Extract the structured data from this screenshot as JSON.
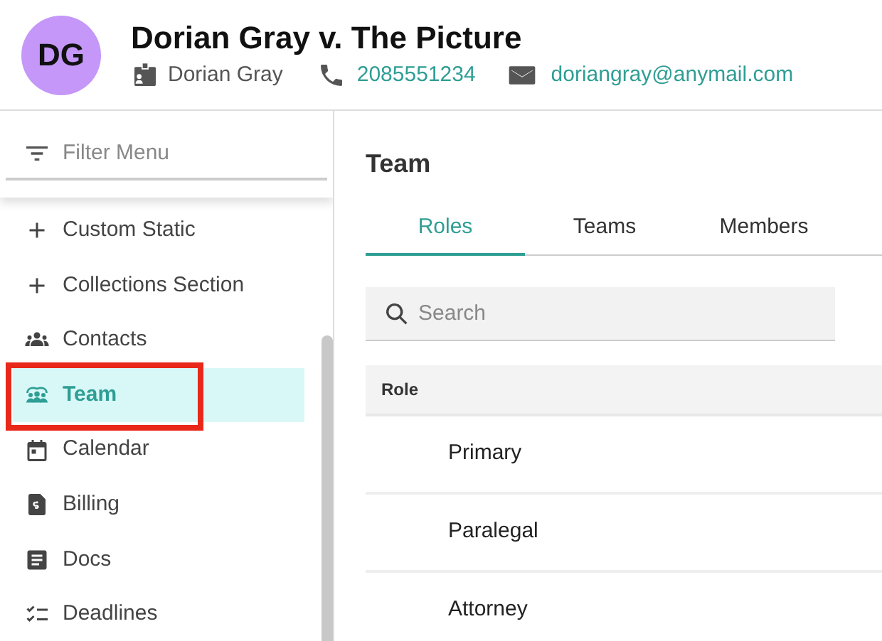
{
  "header": {
    "avatar": "DG",
    "title": "Dorian Gray v. The Picture",
    "client": "Dorian Gray",
    "phone": "2085551234",
    "email": "doriangray@anymail.com"
  },
  "sidebar": {
    "filter": {
      "placeholder": "Filter Menu"
    },
    "items": [
      {
        "label": "Custom Static",
        "kind": "plus",
        "selected": false,
        "outlined": false
      },
      {
        "label": "Collections Section",
        "kind": "plus",
        "selected": false,
        "outlined": false
      },
      {
        "label": "Contacts",
        "kind": "people",
        "selected": false,
        "outlined": false
      },
      {
        "label": "Team",
        "kind": "team",
        "selected": true,
        "outlined": true
      },
      {
        "label": "Calendar",
        "kind": "calendar",
        "selected": false,
        "outlined": false
      },
      {
        "label": "Billing",
        "kind": "billing",
        "selected": false,
        "outlined": false
      },
      {
        "label": "Docs",
        "kind": "docs",
        "selected": false,
        "outlined": false
      },
      {
        "label": "Deadlines",
        "kind": "checklist",
        "selected": false,
        "outlined": false
      }
    ]
  },
  "main": {
    "title": "Team",
    "tabs": [
      {
        "label": "Roles",
        "selected": true
      },
      {
        "label": "Teams",
        "selected": false
      },
      {
        "label": "Members",
        "selected": false
      }
    ],
    "search": {
      "placeholder": "Search"
    },
    "table": {
      "columns": [
        "Role"
      ],
      "rows": [
        [
          "Primary"
        ],
        [
          "Paralegal"
        ],
        [
          "Attorney"
        ]
      ]
    }
  }
}
